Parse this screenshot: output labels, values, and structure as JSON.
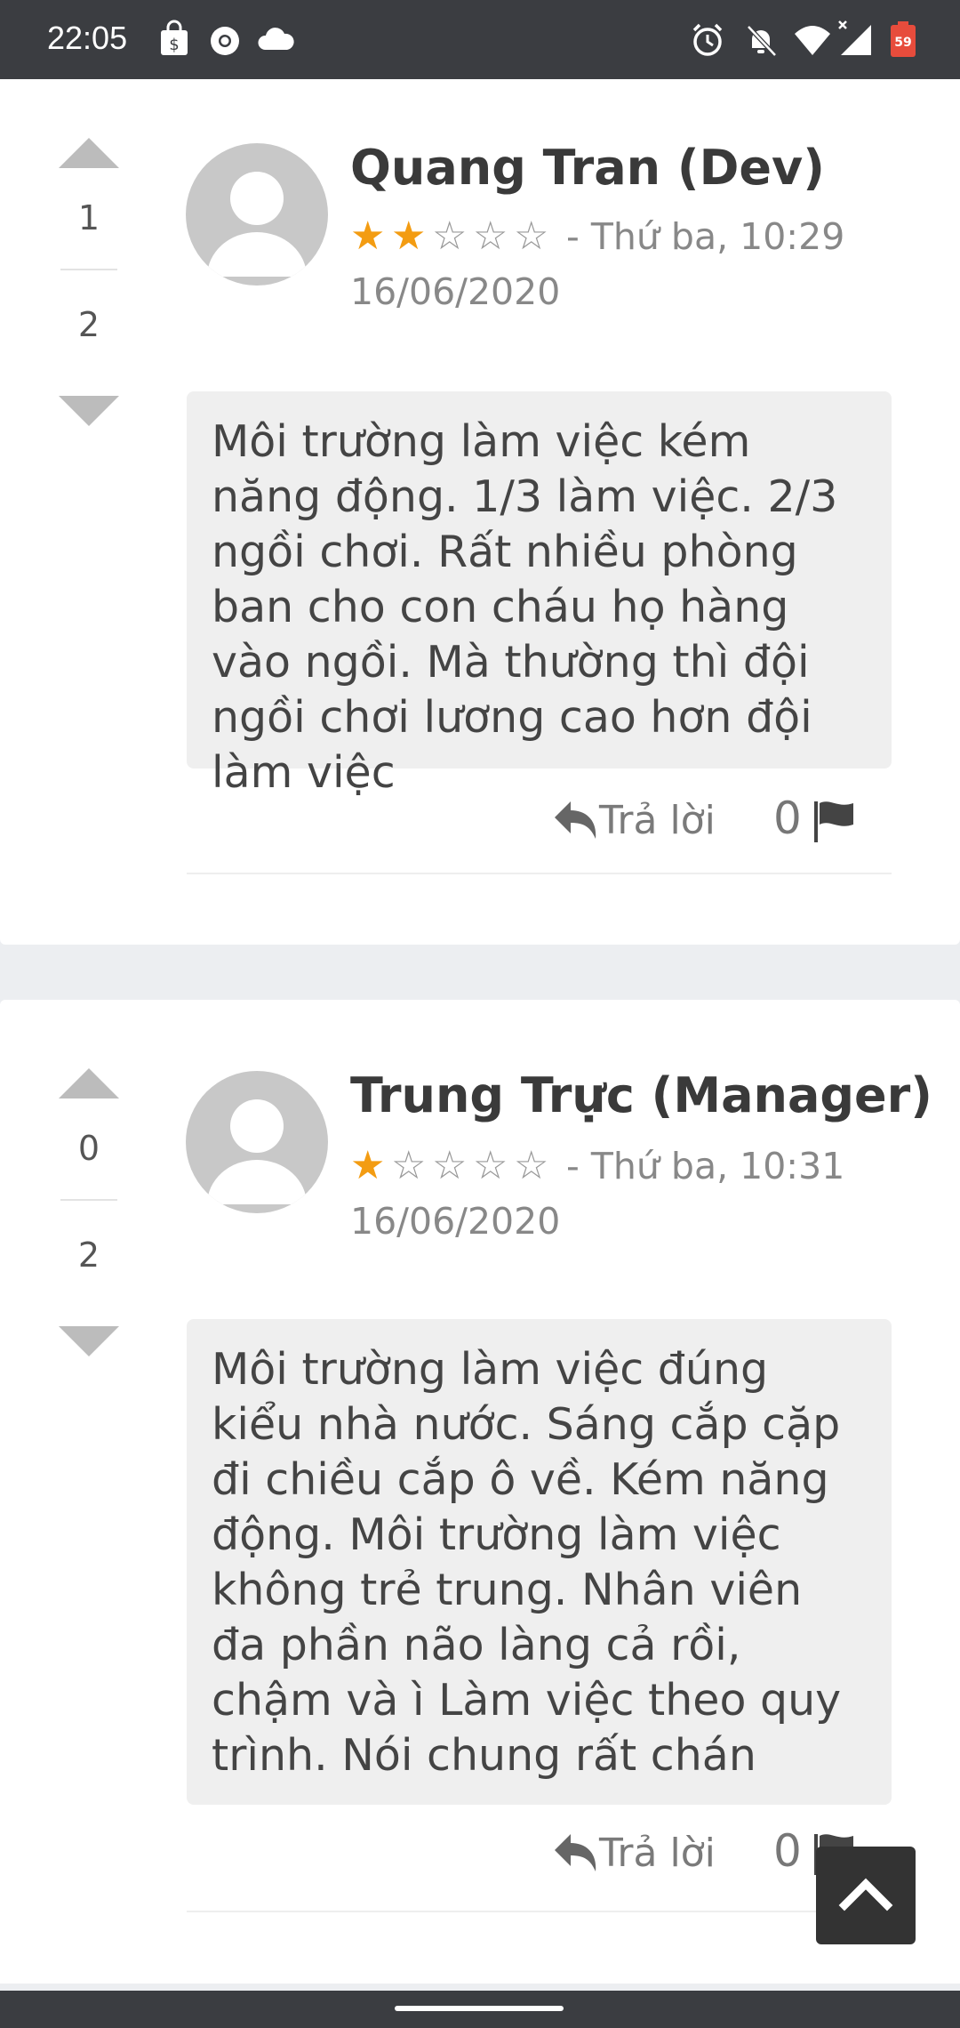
{
  "status_bar": {
    "time": "22:05",
    "left_icons": [
      "shopping-bag-icon",
      "chrome-icon",
      "cloud-icon"
    ],
    "right_icons": [
      "alarm-icon",
      "notifications-off-icon",
      "wifi-icon",
      "signal-icon",
      "battery-icon"
    ],
    "battery_level": "59"
  },
  "reviews": [
    {
      "upvotes": "1",
      "downvotes": "2",
      "author": "Quang Tran (Dev)",
      "rating": 2,
      "max_rating": 5,
      "date_line1": "- Thứ ba, 10:29",
      "date_line2": "16/06/2020",
      "text": "Môi trường làm việc kém năng động. 1/3 làm việc. 2/3 ngồi chơi. Rất nhiều phòng ban cho con cháu họ hàng vào ngồi. Mà thường thì đội ngồi chơi lương cao hơn đội làm việc",
      "reply_label": "Trả lời",
      "flag_count": "0"
    },
    {
      "upvotes": "0",
      "downvotes": "2",
      "author": "Trung Trực (Manager)",
      "rating": 1,
      "max_rating": 5,
      "date_line1": "- Thứ ba, 10:31",
      "date_line2": "16/06/2020",
      "text": "Môi trường làm việc đúng kiểu nhà nước. Sáng cắp cặp đi chiều cắp ô về. Kém năng động. Môi trường làm việc không trẻ trung. Nhân viên đa phần não làng cả rồi, chậm và ì Làm việc theo quy trình. Nói chung rất chán",
      "reply_label": "Trả lời",
      "flag_count": "0"
    }
  ],
  "colors": {
    "star_filled": "#f39c12",
    "star_empty": "#999999",
    "status_bar": "#3b3d41"
  }
}
